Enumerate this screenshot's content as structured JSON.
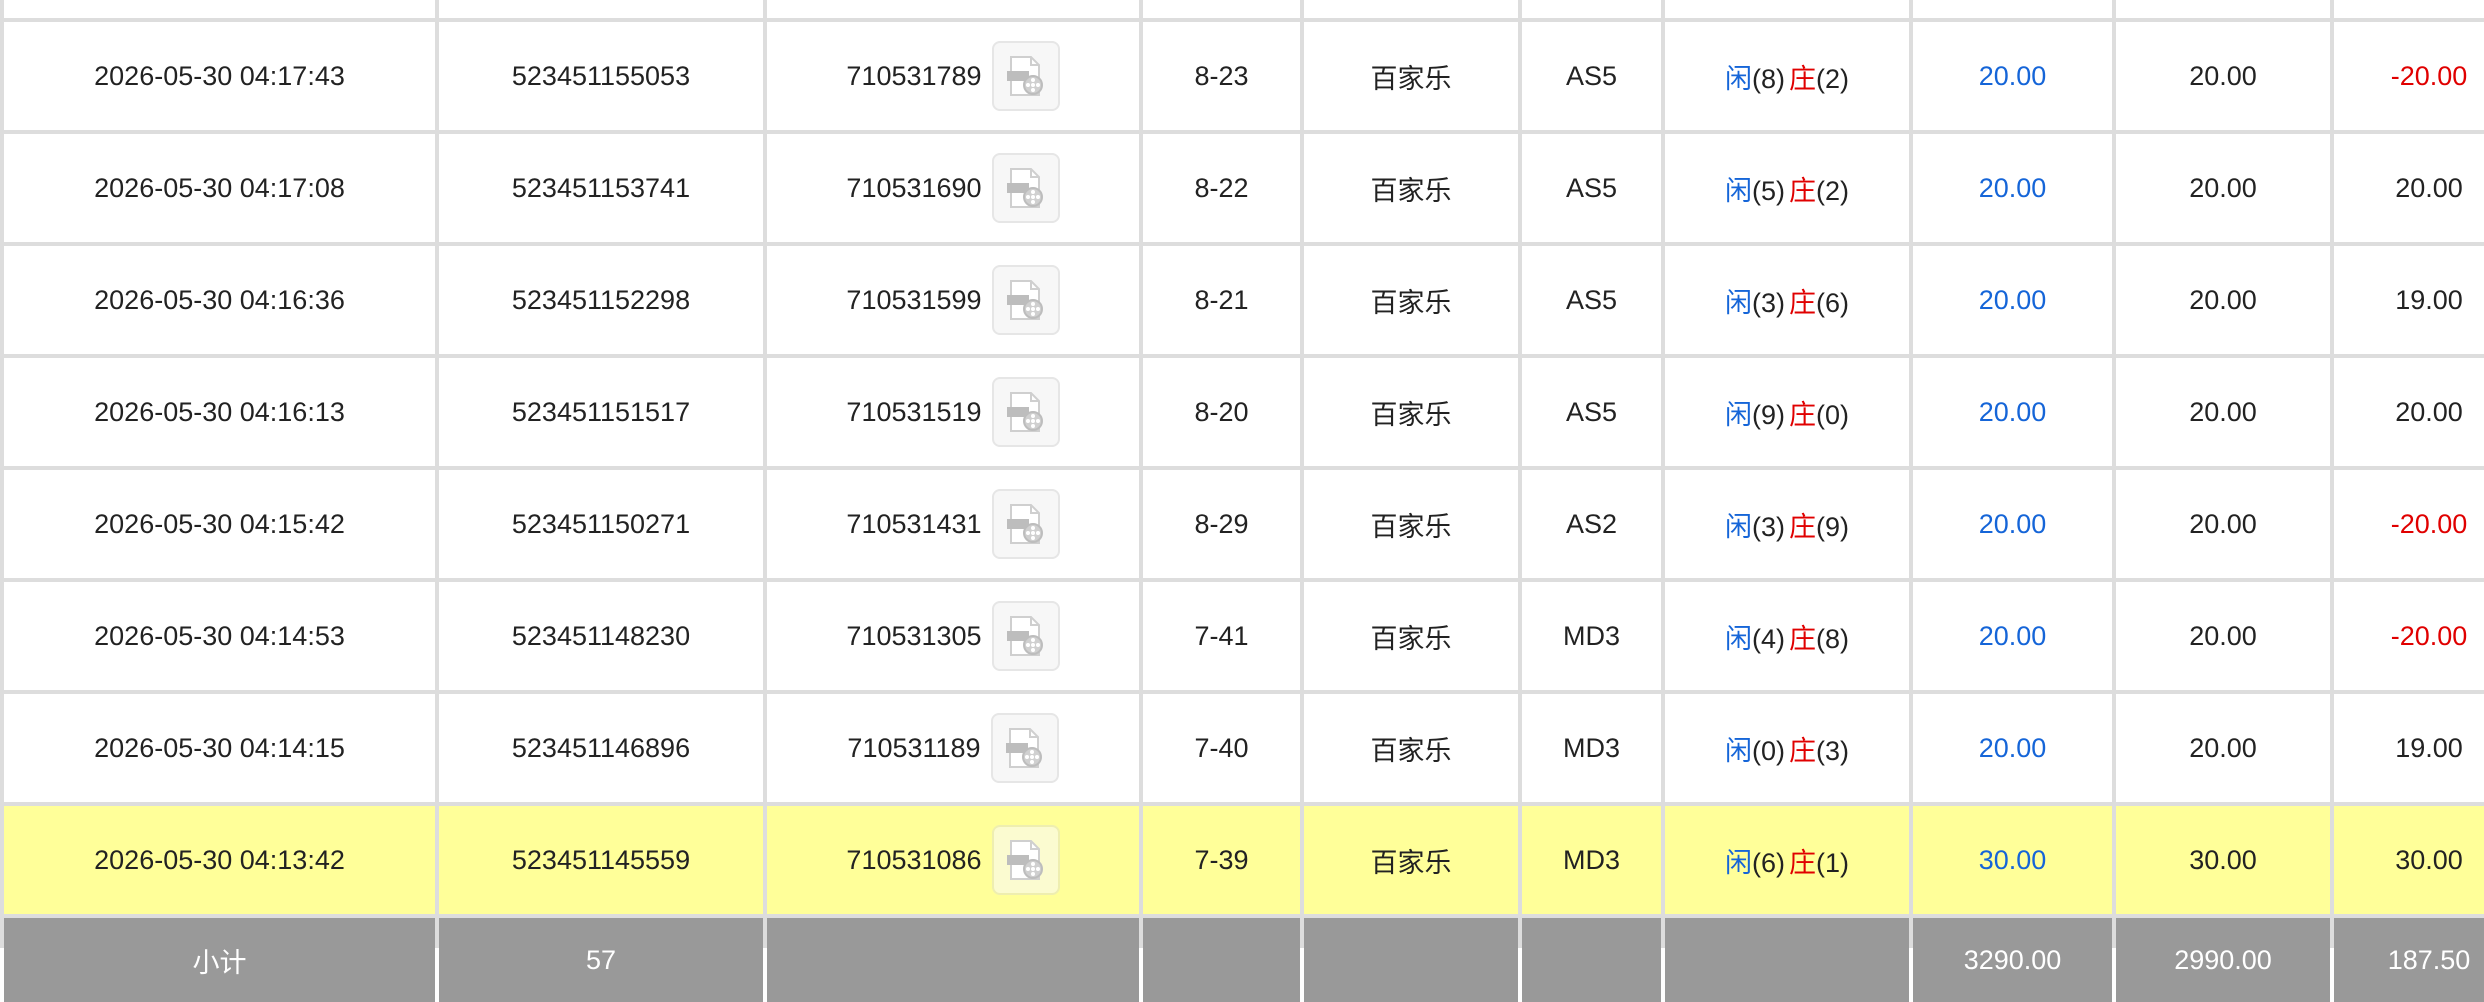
{
  "icons": {
    "replay": "film-reel-document-icon"
  },
  "colors": {
    "blue": "#1565d8",
    "red": "#e00000",
    "highlight": "#ffff99",
    "footer": "#999999"
  },
  "rows": [
    {
      "time": "2026-05-30 04:17:43",
      "order": "523451155053",
      "game_id": "710531789",
      "shoe": "8-23",
      "game": "百家乐",
      "table": "AS5",
      "player_label": "闲",
      "player_val": "(8)",
      "banker_label": "庄",
      "banker_val": "(2)",
      "bet": "20.00",
      "valid": "20.00",
      "win": "-20.00",
      "win_color": "red"
    },
    {
      "time": "2026-05-30 04:17:08",
      "order": "523451153741",
      "game_id": "710531690",
      "shoe": "8-22",
      "game": "百家乐",
      "table": "AS5",
      "player_label": "闲",
      "player_val": "(5)",
      "banker_label": "庄",
      "banker_val": "(2)",
      "bet": "20.00",
      "valid": "20.00",
      "win": "20.00",
      "win_color": "black"
    },
    {
      "time": "2026-05-30 04:16:36",
      "order": "523451152298",
      "game_id": "710531599",
      "shoe": "8-21",
      "game": "百家乐",
      "table": "AS5",
      "player_label": "闲",
      "player_val": "(3)",
      "banker_label": "庄",
      "banker_val": "(6)",
      "bet": "20.00",
      "valid": "20.00",
      "win": "19.00",
      "win_color": "black"
    },
    {
      "time": "2026-05-30 04:16:13",
      "order": "523451151517",
      "game_id": "710531519",
      "shoe": "8-20",
      "game": "百家乐",
      "table": "AS5",
      "player_label": "闲",
      "player_val": "(9)",
      "banker_label": "庄",
      "banker_val": "(0)",
      "bet": "20.00",
      "valid": "20.00",
      "win": "20.00",
      "win_color": "black"
    },
    {
      "time": "2026-05-30 04:15:42",
      "order": "523451150271",
      "game_id": "710531431",
      "shoe": "8-29",
      "game": "百家乐",
      "table": "AS2",
      "player_label": "闲",
      "player_val": "(3)",
      "banker_label": "庄",
      "banker_val": "(9)",
      "bet": "20.00",
      "valid": "20.00",
      "win": "-20.00",
      "win_color": "red"
    },
    {
      "time": "2026-05-30 04:14:53",
      "order": "523451148230",
      "game_id": "710531305",
      "shoe": "7-41",
      "game": "百家乐",
      "table": "MD3",
      "player_label": "闲",
      "player_val": "(4)",
      "banker_label": "庄",
      "banker_val": "(8)",
      "bet": "20.00",
      "valid": "20.00",
      "win": "-20.00",
      "win_color": "red"
    },
    {
      "time": "2026-05-30 04:14:15",
      "order": "523451146896",
      "game_id": "710531189",
      "shoe": "7-40",
      "game": "百家乐",
      "table": "MD3",
      "player_label": "闲",
      "player_val": "(0)",
      "banker_label": "庄",
      "banker_val": "(3)",
      "bet": "20.00",
      "valid": "20.00",
      "win": "19.00",
      "win_color": "black"
    },
    {
      "time": "2026-05-30 04:13:42",
      "order": "523451145559",
      "game_id": "710531086",
      "shoe": "7-39",
      "game": "百家乐",
      "table": "MD3",
      "player_label": "闲",
      "player_val": "(6)",
      "banker_label": "庄",
      "banker_val": "(1)",
      "bet": "30.00",
      "valid": "30.00",
      "win": "30.00",
      "win_color": "black"
    }
  ],
  "footer": {
    "label": "小计",
    "count": "57",
    "bet_total": "3290.00",
    "valid_total": "2990.00",
    "win_total": "187.50"
  }
}
